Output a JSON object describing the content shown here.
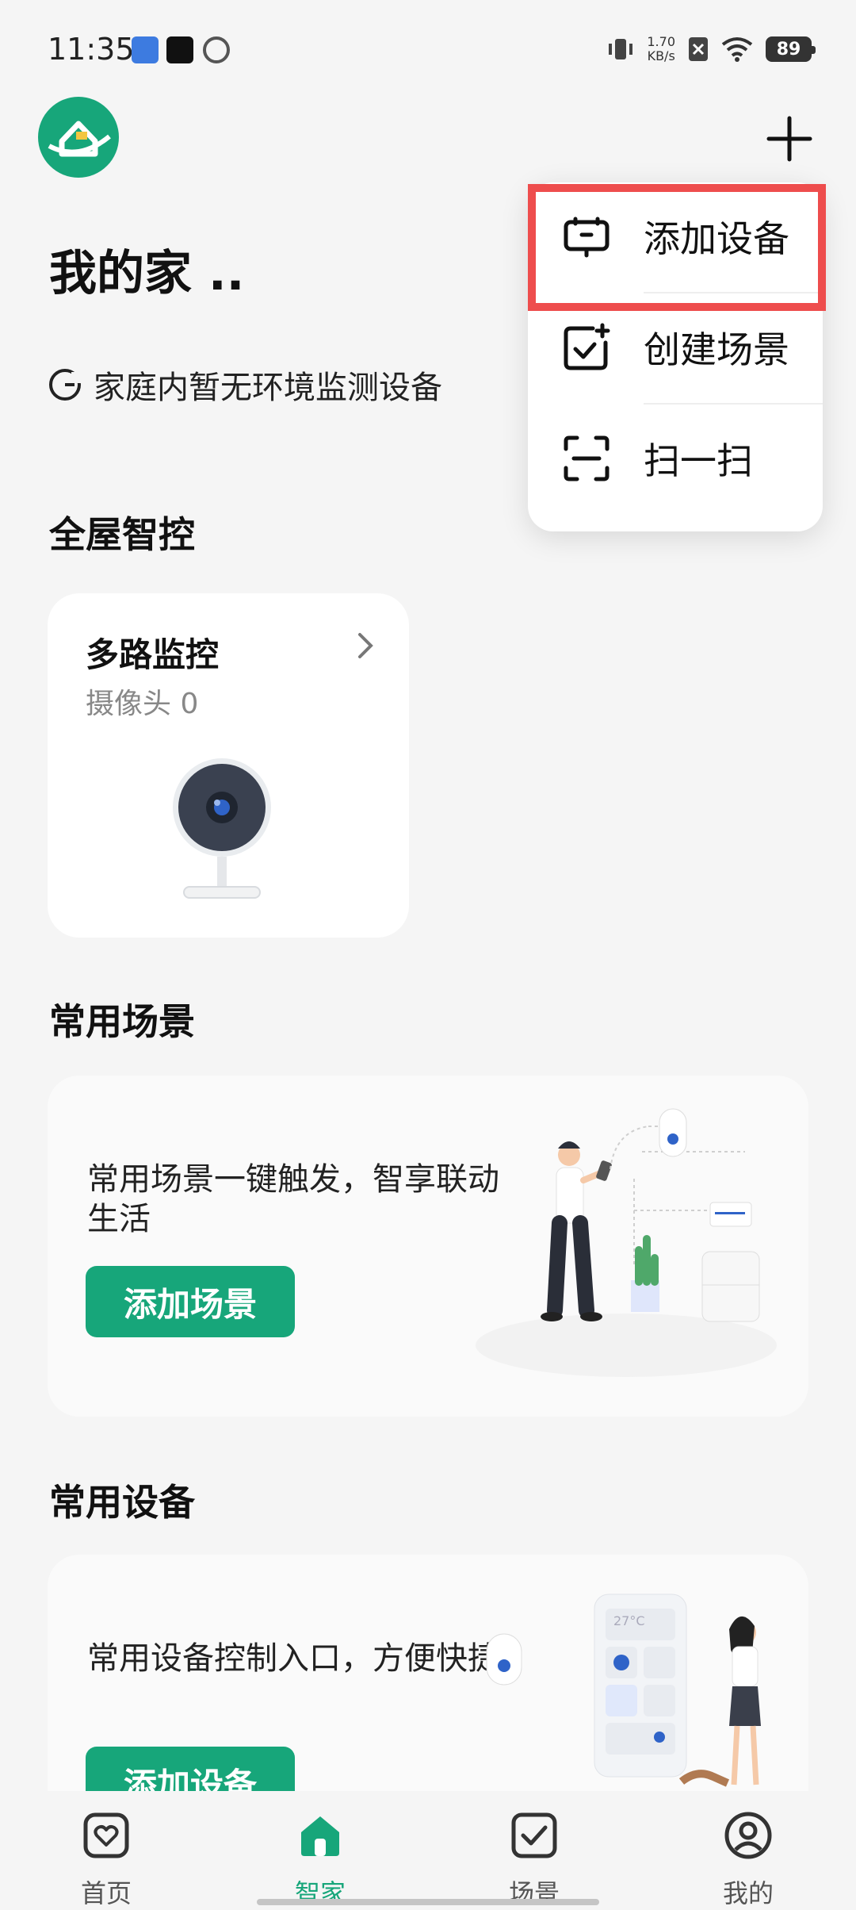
{
  "status_bar": {
    "time": "11:35",
    "net_speed_value": "1.70",
    "net_speed_unit": "KB/s",
    "battery": "89"
  },
  "header": {
    "home_title": "我的家 ..",
    "env_text": "家庭内暂无环境监测设备"
  },
  "popup_menu": {
    "items": [
      {
        "label": "添加设备",
        "icon": "device-icon"
      },
      {
        "label": "创建场景",
        "icon": "scene-add-icon"
      },
      {
        "label": "扫一扫",
        "icon": "scan-icon"
      }
    ]
  },
  "whole_house": {
    "title": "全屋智控",
    "card": {
      "title": "多路监控",
      "subtitle": "摄像头 0"
    }
  },
  "scenes": {
    "title": "常用场景",
    "desc": "常用场景一键触发，智享联动生活",
    "button": "添加场景",
    "illustration_temp": ""
  },
  "devices": {
    "title": "常用设备",
    "desc": "常用设备控制入口，方便快捷",
    "button": "添加设备",
    "illustration_temp": "27°C"
  },
  "bottom_nav": {
    "items": [
      {
        "label": "首页",
        "active": false
      },
      {
        "label": "智家",
        "active": true
      },
      {
        "label": "场景",
        "active": false
      },
      {
        "label": "我的",
        "active": false
      }
    ]
  },
  "colors": {
    "accent": "#17a67a",
    "highlight": "#ee4d4d"
  }
}
